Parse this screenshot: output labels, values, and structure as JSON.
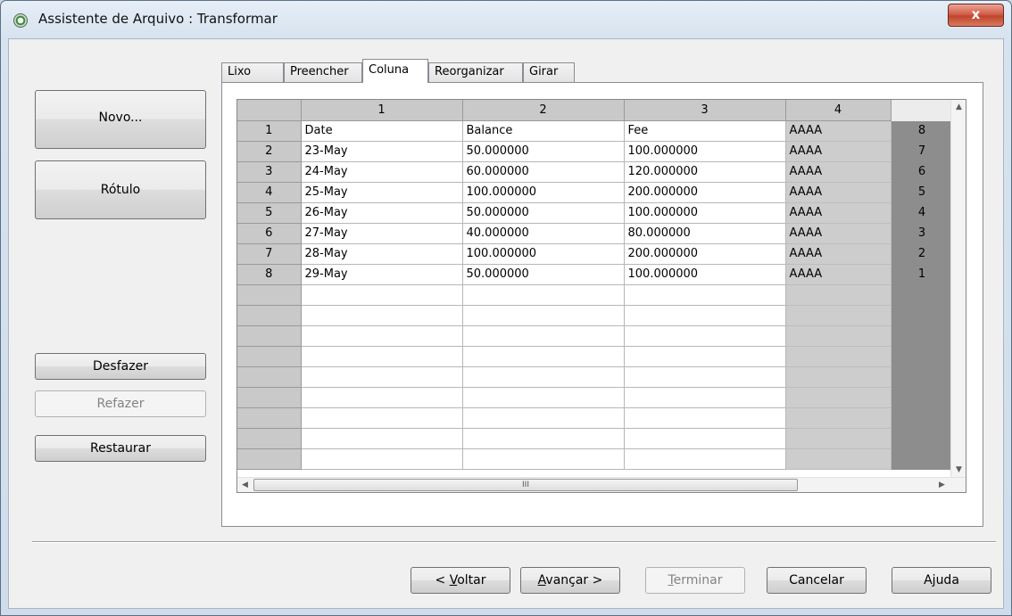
{
  "window": {
    "title": "Assistente de Arquivo : Transformar",
    "close_label": "x"
  },
  "left_buttons": {
    "new": "Novo...",
    "label": "Rótulo",
    "undo": "Desfazer",
    "redo": "Refazer",
    "restore": "Restaurar"
  },
  "tabs": [
    "Lixo",
    "Preencher",
    "Coluna",
    "Reorganizar",
    "Girar"
  ],
  "active_tab": "Coluna",
  "grid": {
    "columns": [
      "1",
      "2",
      "3",
      "4",
      ""
    ],
    "rows": [
      [
        "1",
        "Date",
        "Balance",
        "Fee",
        "AAAA",
        "8"
      ],
      [
        "2",
        "23-May",
        "50.000000",
        "100.000000",
        "AAAA",
        "7"
      ],
      [
        "3",
        "24-May",
        "60.000000",
        "120.000000",
        "AAAA",
        "6"
      ],
      [
        "4",
        "25-May",
        "100.000000",
        "200.000000",
        "AAAA",
        "5"
      ],
      [
        "5",
        "26-May",
        "50.000000",
        "100.000000",
        "AAAA",
        "4"
      ],
      [
        "6",
        "27-May",
        "40.000000",
        "80.000000",
        "AAAA",
        "3"
      ],
      [
        "7",
        "28-May",
        "100.000000",
        "200.000000",
        "AAAA",
        "2"
      ],
      [
        "8",
        "29-May",
        "50.000000",
        "100.000000",
        "AAAA",
        "1"
      ]
    ],
    "empty_rows": 9,
    "scroll_thumb_label": "III"
  },
  "footer": {
    "back_prefix": "< ",
    "back_mnemonic": "V",
    "back_rest": "oltar",
    "next_mnemonic": "A",
    "next_rest": "vançar >",
    "finish_mnemonic": "T",
    "finish_rest": "erminar",
    "cancel": "Cancelar",
    "help_a": "A",
    "help_mnemonic": "j",
    "help_rest": "uda"
  },
  "icons": {
    "app": "qlik-app-icon",
    "close": "close-icon",
    "scroll_up": "▲",
    "scroll_down": "▼",
    "scroll_left": "◀",
    "scroll_right": "▶"
  },
  "colors": {
    "close_red": "#c0442c",
    "window_border": "#5c6f86"
  }
}
